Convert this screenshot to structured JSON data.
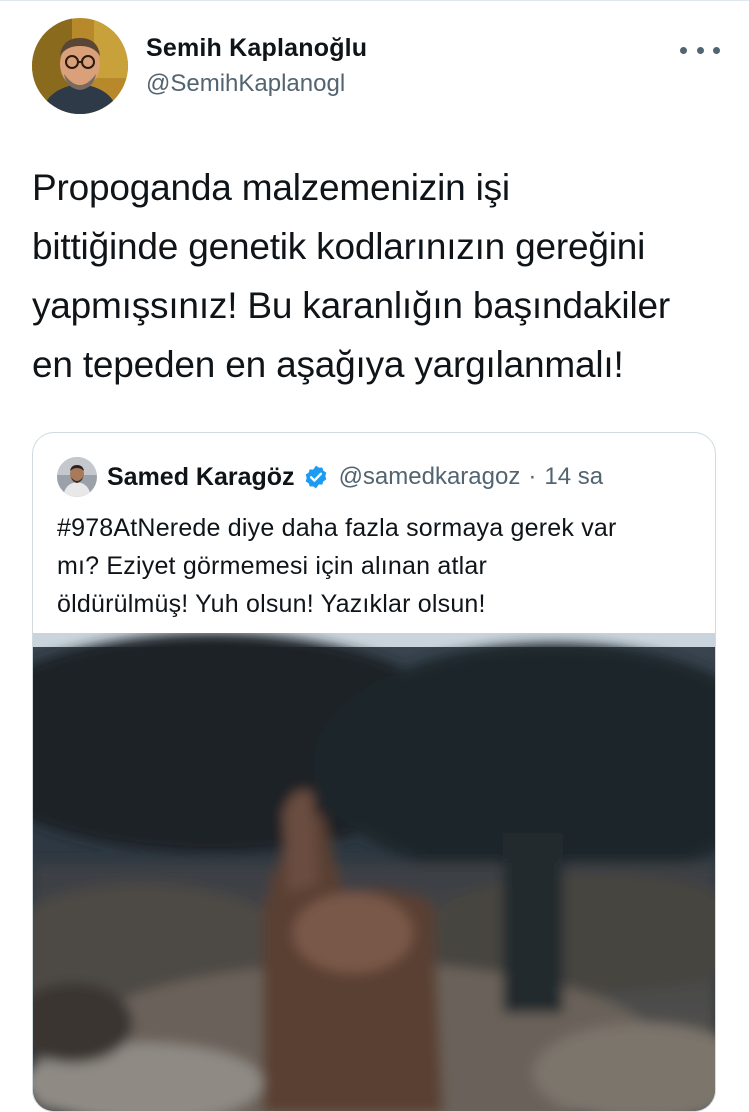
{
  "tweet": {
    "author": {
      "name": "Semih Kaplanoğlu",
      "handle": "@SemihKaplanogl"
    },
    "text": "Propoganda malzemenizin işi\nbittiğinde genetik kodlarınızın gereğini\nyapmışsınız! Bu karanlığın başındakiler\nen tepeden en aşağıya yargılanmalı!",
    "more_icon": "more-horizontal-icon"
  },
  "quoted_tweet": {
    "author": {
      "name": "Samed Karagöz",
      "handle": "@samedkaragoz",
      "verified": true
    },
    "separator": "·",
    "time": "14 sa",
    "text": "#978AtNerede diye daha fazla sormaya gerek var\nmı? Eziyet görmemesi için alınan atlar\nöldürülmüş! Yuh olsun! Yazıklar olsun!",
    "verified_icon": "verified-badge-icon"
  },
  "colors": {
    "text_primary": "#0f1419",
    "text_secondary": "#536471",
    "border": "#cfd9de",
    "verified": "#1d9bf0"
  }
}
